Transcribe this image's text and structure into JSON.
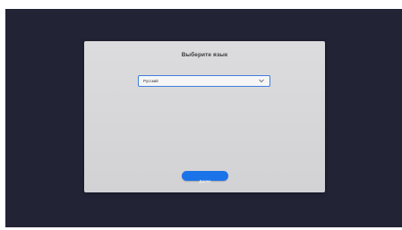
{
  "dialog": {
    "title": "Выберите язык",
    "language_select": {
      "value": "Русский"
    },
    "next_button_label": "Далее"
  },
  "colors": {
    "desktop_background": "#222335",
    "dialog_background": "#d7d7da",
    "accent": "#1a73e8"
  },
  "icons": {
    "select_arrow": "chevron-down-icon"
  }
}
